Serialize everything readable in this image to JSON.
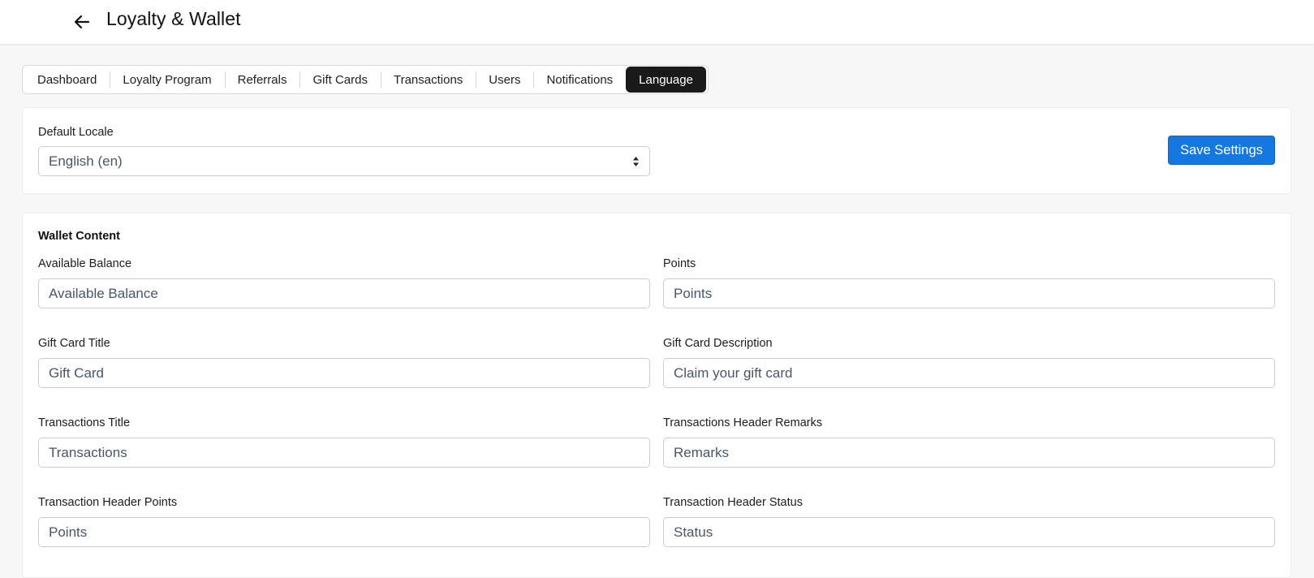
{
  "header": {
    "title": "Loyalty & Wallet"
  },
  "tabs": [
    {
      "label": "Dashboard"
    },
    {
      "label": "Loyalty Program"
    },
    {
      "label": "Referrals"
    },
    {
      "label": "Gift Cards"
    },
    {
      "label": "Transactions"
    },
    {
      "label": "Users"
    },
    {
      "label": "Notifications"
    },
    {
      "label": "Language"
    }
  ],
  "active_tab": "Language",
  "locale": {
    "label": "Default Locale",
    "selected": "English (en)",
    "save_label": "Save Settings"
  },
  "wallet": {
    "section_title": "Wallet Content",
    "fields": [
      {
        "label": "Available Balance",
        "value": "Available Balance"
      },
      {
        "label": "Points",
        "value": "Points"
      },
      {
        "label": "Gift Card Title",
        "value": "Gift Card"
      },
      {
        "label": "Gift Card Description",
        "value": "Claim your gift card"
      },
      {
        "label": "Transactions Title",
        "value": "Transactions"
      },
      {
        "label": "Transactions Header Remarks",
        "value": "Remarks"
      },
      {
        "label": "Transaction Header Points",
        "value": "Points"
      },
      {
        "label": "Transaction Header Status",
        "value": "Status"
      }
    ]
  },
  "colors": {
    "primary_button": "#1578e0",
    "active_tab": "#1a1a1a"
  }
}
